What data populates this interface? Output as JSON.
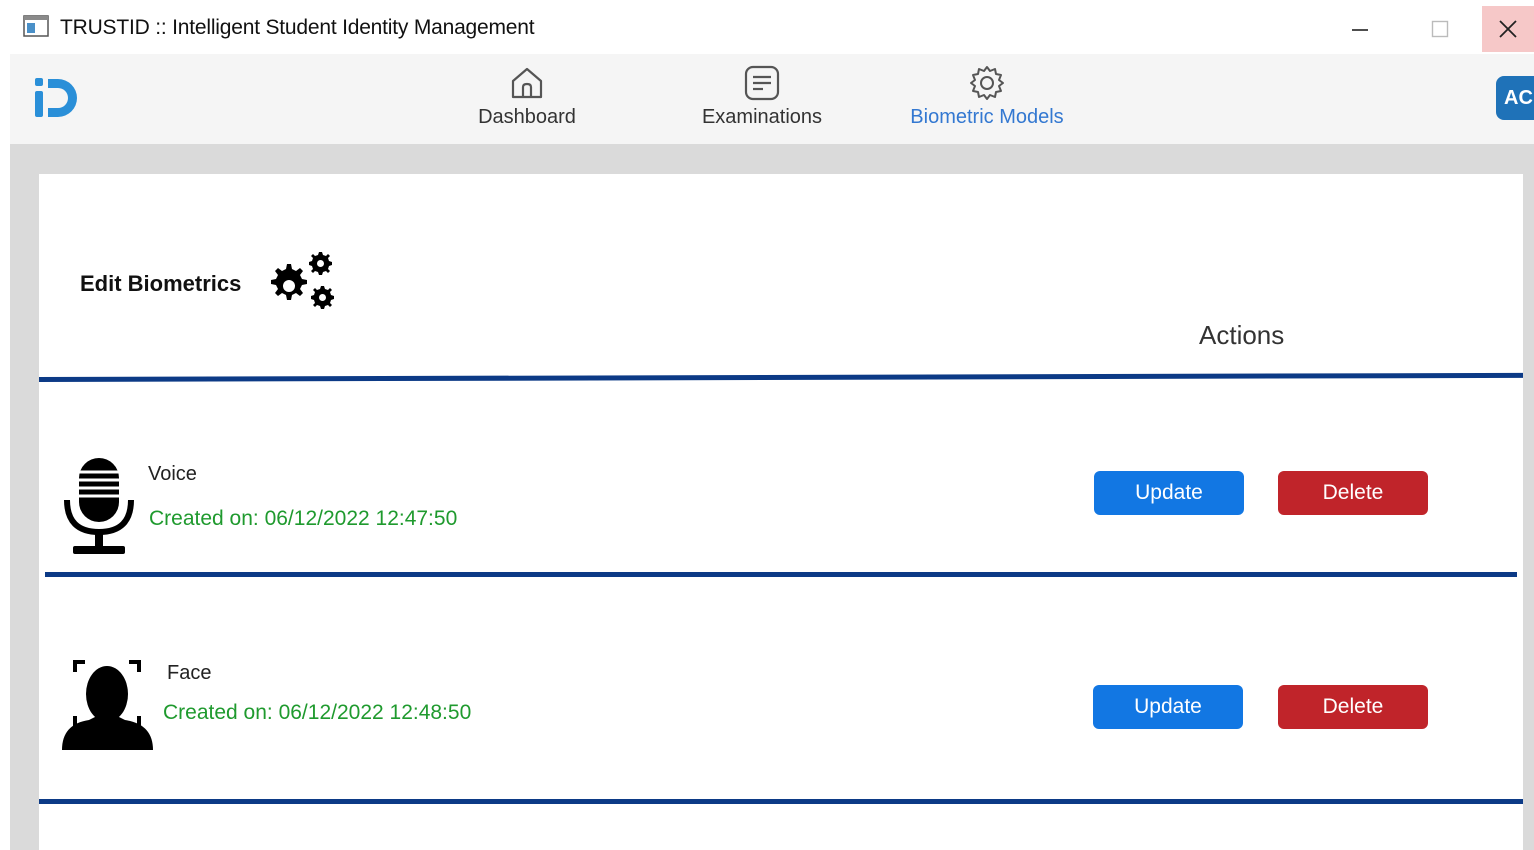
{
  "window": {
    "title": "TRUSTID :: Intelligent Student Identity Management"
  },
  "nav": {
    "items": [
      {
        "label": "Dashboard",
        "icon": "home-icon"
      },
      {
        "label": "Examinations",
        "icon": "document-icon"
      },
      {
        "label": "Biometric Models",
        "icon": "gear-icon",
        "active": true
      }
    ],
    "avatar_initials": "AC",
    "active_color": "#3378d1"
  },
  "page": {
    "title": "Edit Biometrics",
    "actions_header": "Actions"
  },
  "biometrics": [
    {
      "name": "Voice",
      "created": "Created on: 06/12/2022 12:47:50",
      "icon": "microphone-icon",
      "update_label": "Update",
      "delete_label": "Delete"
    },
    {
      "name": "Face",
      "created": "Created on: 06/12/2022 12:48:50",
      "icon": "face-scan-icon",
      "update_label": "Update",
      "delete_label": "Delete"
    }
  ],
  "colors": {
    "divider": "#0c3a86",
    "update_button": "#1277e3",
    "delete_button": "#c0242a",
    "date_text": "#1f9a2e"
  }
}
